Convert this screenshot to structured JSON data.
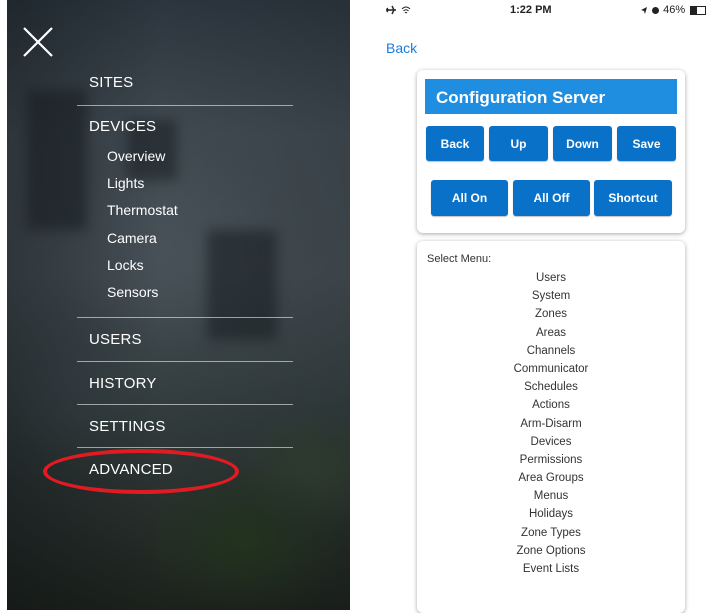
{
  "nav_menu": {
    "items": [
      {
        "label": "SITES"
      },
      {
        "label": "DEVICES"
      },
      {
        "label": "USERS"
      },
      {
        "label": "HISTORY"
      },
      {
        "label": "SETTINGS"
      },
      {
        "label": "ADVANCED"
      }
    ],
    "devices_subitems": [
      "Overview",
      "Lights",
      "Thermostat",
      "Camera",
      "Locks",
      "Sensors"
    ],
    "close_icon": "close-icon",
    "highlight_color": "#e21b22"
  },
  "status_bar": {
    "left_icons": "airplane-icon wifi-icon",
    "time": "1:22 PM",
    "battery_text": "46%"
  },
  "header": {
    "back_label": "Back"
  },
  "config_server": {
    "title": "Configuration Server",
    "buttons_row1": [
      "Back",
      "Up",
      "Down",
      "Save"
    ],
    "buttons_row2": [
      "All On",
      "All Off",
      "Shortcut"
    ],
    "accent_color": "#1f8de0",
    "button_color": "#0a71c8"
  },
  "select_menu": {
    "label": "Select Menu:",
    "options": [
      "Users",
      "System",
      "Zones",
      "Areas",
      "Channels",
      "Communicator",
      "Schedules",
      "Actions",
      "Arm-Disarm",
      "Devices",
      "Permissions",
      "Area Groups",
      "Menus",
      "Holidays",
      "Zone Types",
      "Zone Options",
      "Event Lists"
    ]
  }
}
